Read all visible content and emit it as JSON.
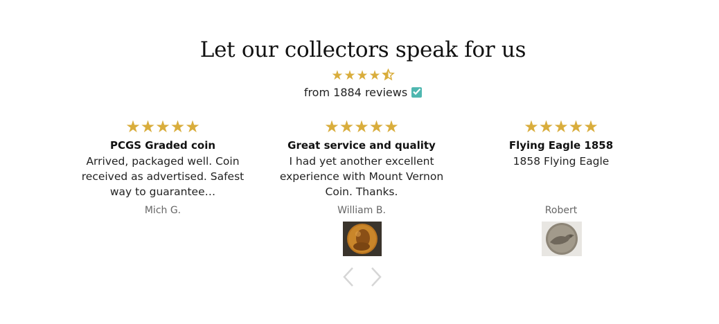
{
  "heading": "Let our collectors speak for us",
  "summary": {
    "stars": "★★★★",
    "half_star": "⯪",
    "review_count_text": "from 1884 reviews",
    "verified_icon": "verified-check-icon"
  },
  "colors": {
    "star": "#d9ad3c",
    "verified": "#4fb7b0",
    "arrow": "#d6d6d6"
  },
  "reviews": [
    {
      "stars": "★★★★★",
      "title": "PCGS Graded coin",
      "body": "Arrived, packaged well. Coin received as advertised. Safest way to guarantee…",
      "reviewer": "Mich G."
    },
    {
      "stars": "★★★★★",
      "title": "Great service and quality",
      "body": "I had yet another excellent experience with Mount Vernon Coin. Thanks.",
      "reviewer": "William B."
    },
    {
      "stars": "★★★★★",
      "title": "Flying Eagle 1858",
      "body": "1858 Flying Eagle",
      "reviewer": "Robert"
    }
  ],
  "carousel": {
    "prev_icon": "chevron-left-icon",
    "next_icon": "chevron-right-icon"
  }
}
